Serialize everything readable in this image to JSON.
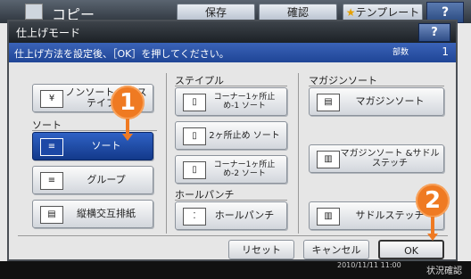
{
  "app": {
    "title": "コピー"
  },
  "top_buttons": {
    "save": "保存",
    "confirm": "確認",
    "template": "テンプレート",
    "help": "?"
  },
  "dialog": {
    "title": "仕上げモード",
    "help": "?",
    "message": "仕上げ方法を設定後、［OK］を押してください。",
    "copies_label": "部数",
    "copies_value": "1"
  },
  "sections": {
    "sort": "ソート",
    "staple": "ステイプル",
    "magazine": "マガジンソート",
    "punch": "ホールパンチ"
  },
  "buttons": {
    "nonsort": "ノンソート ノンステイプル",
    "sort": "ソート",
    "group": "グループ",
    "rotate": "縦横交互排紙",
    "staple_1": "コーナー1ヶ所止め-1 ソート",
    "staple_2": "2ヶ所止め ソート",
    "staple_3": "コーナー1ヶ所止め-2 ソート",
    "punch": "ホールパンチ",
    "magazine": "マガジンソート",
    "magazine_saddle": "マガジンソート &サドルステッチ",
    "saddle": "サドルステッチ"
  },
  "footer": {
    "reset": "リセット",
    "cancel": "キャンセル",
    "ok": "OK"
  },
  "annotations": {
    "one": "1",
    "two": "2"
  },
  "status": {
    "job_status": "状況確認",
    "time": "2010/11/11 11:00"
  },
  "colors": {
    "accent": "#ef7a22",
    "selected": "#1f4596"
  }
}
